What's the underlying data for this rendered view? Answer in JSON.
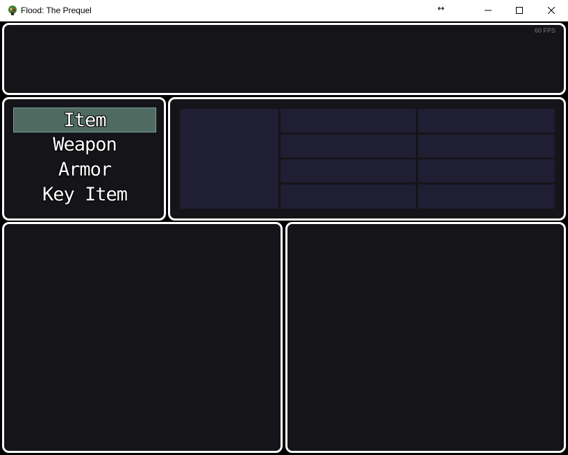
{
  "window": {
    "title": "Flood: The Prequel",
    "icon": "game-app-icon",
    "controls": [
      "minimize-icon",
      "maximize-icon",
      "close-icon"
    ]
  },
  "game": {
    "fps_label": "60 FPS",
    "menu": {
      "categories": [
        {
          "label": "Item",
          "selected": true
        },
        {
          "label": "Weapon",
          "selected": false
        },
        {
          "label": "Armor",
          "selected": false
        },
        {
          "label": "Key Item",
          "selected": false
        }
      ]
    },
    "colors": {
      "panel_bg": "#151418",
      "panel_border": "#ffffff",
      "selection": "#4f6b61",
      "cell_bg": "#1f1e33"
    }
  }
}
